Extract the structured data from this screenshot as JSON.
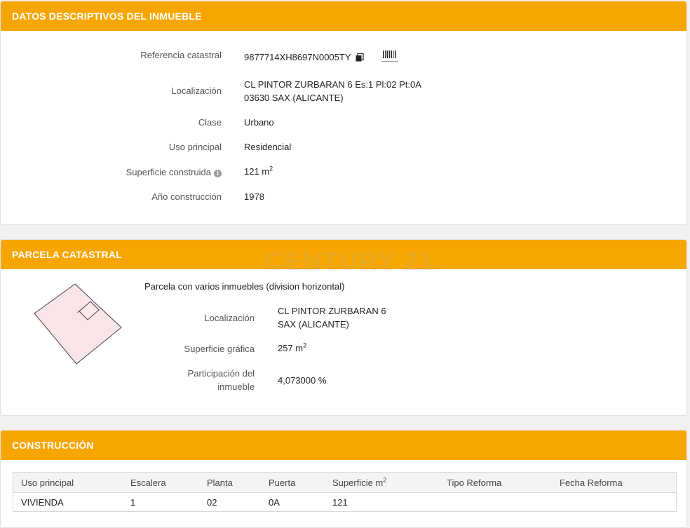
{
  "datos": {
    "header": "DATOS DESCRIPTIVOS DEL INMUEBLE",
    "referencia_label": "Referencia catastral",
    "referencia_value": "9877714XH8697N0005TY",
    "localizacion_label": "Localización",
    "localizacion_line1": "CL PINTOR ZURBARAN 6 Es:1 Pl:02 Pt:0A",
    "localizacion_line2": "03630 SAX (ALICANTE)",
    "clase_label": "Clase",
    "clase_value": "Urbano",
    "uso_label": "Uso principal",
    "uso_value": "Residencial",
    "superficie_label": "Superficie construida",
    "superficie_value": "121 m",
    "superficie_unit_sup": "2",
    "anio_label": "Año construcción",
    "anio_value": "1978"
  },
  "parcela": {
    "header": "PARCELA CATASTRAL",
    "watermark": "CENTURY 21",
    "description": "Parcela con varios inmuebles (division horizontal)",
    "localizacion_label": "Localización",
    "localizacion_line1": "CL PINTOR ZURBARAN 6",
    "localizacion_line2": "SAX (ALICANTE)",
    "superficie_label": "Superficie gráfica",
    "superficie_value": "257 m",
    "superficie_unit_sup": "2",
    "participacion_label_line1": "Participación del",
    "participacion_label_line2": "inmueble",
    "participacion_value": "4,073000 %",
    "map_fill": "#f9e4e8",
    "map_stroke": "#444444"
  },
  "construccion": {
    "header": "CONSTRUCCIÓN",
    "columns": [
      "Uso principal",
      "Escalera",
      "Planta",
      "Puerta",
      "Superficie m",
      "Tipo Reforma",
      "Fecha Reforma"
    ],
    "superficie_col_sup": "2",
    "rows": [
      [
        "VIVIENDA",
        "1",
        "02",
        "0A",
        "121",
        "",
        ""
      ]
    ]
  },
  "colors": {
    "header_bg": "#f7a600",
    "header_text": "#ffffff"
  },
  "icons": {
    "copy": "copy-icon",
    "barcode": "barcode-icon",
    "info": "info-icon"
  }
}
